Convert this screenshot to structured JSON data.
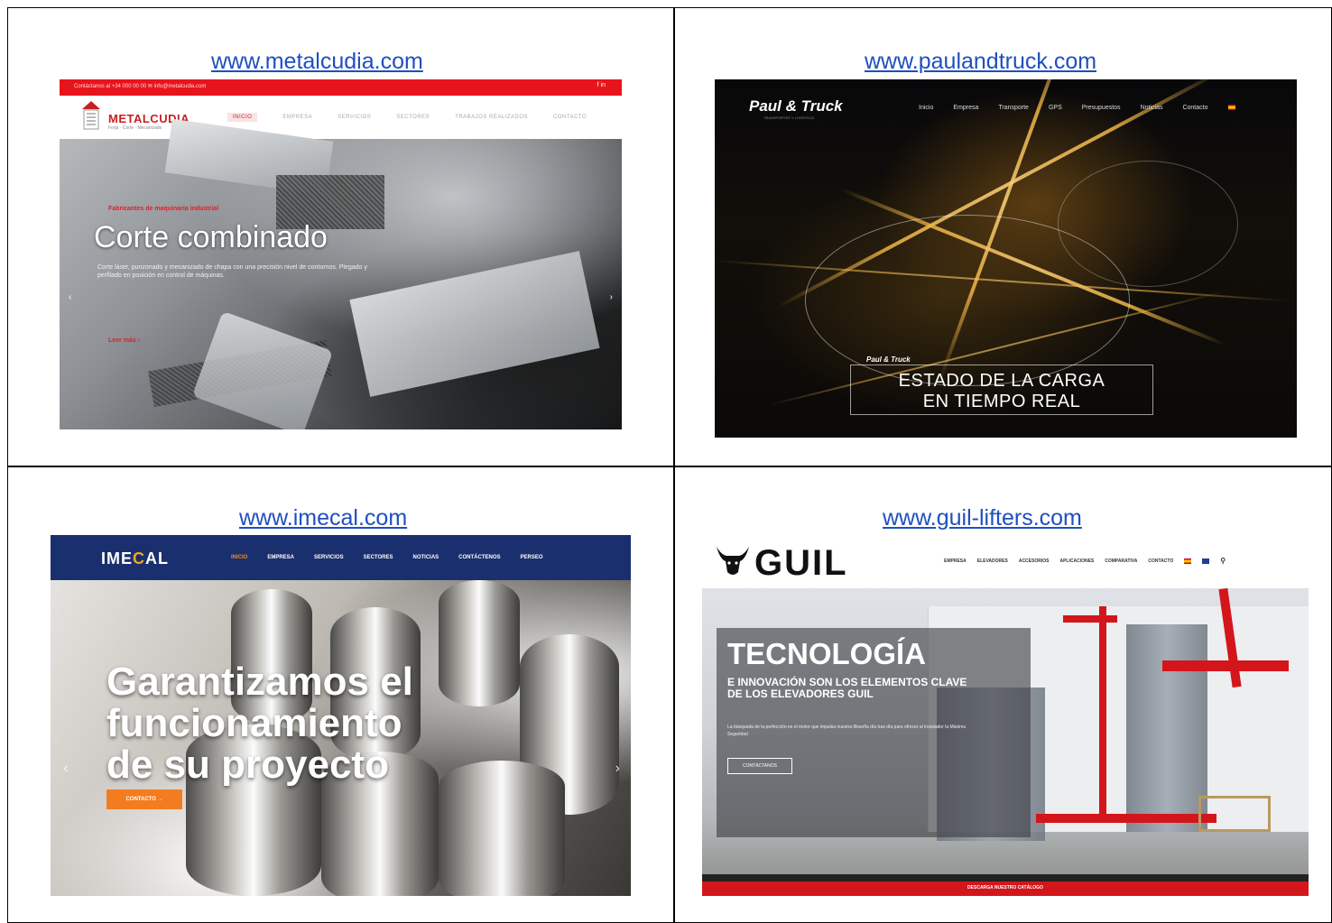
{
  "cells": [
    {
      "url": "www.metalcudia.com",
      "site": {
        "topbar_contact": "Contáctanos al  +34 000 00 00   ✉ info@metalcudia.com",
        "social": "f  in",
        "logo": "METALCUDIA",
        "logo_sub": "Forja · Corte · Mecanizado",
        "menu": [
          "INICIO",
          "EMPRESA",
          "SERVICIOS",
          "SECTORES",
          "TRABAJOS REALIZADOS",
          "CONTACTO"
        ],
        "kicker": "Fabricantes de maquinaria industrial",
        "headline": "Corte combinado",
        "description": "Corte láser, punzonado y mecanizado de chapa con una precisión nivel de contornos. Plegado y perfilado en posición en control de máquinas.",
        "more": "Leer más  ›"
      }
    },
    {
      "url": "www.paulandtruck.com",
      "site": {
        "logo": "Paul & Truck",
        "logo_sub": "TRANSPORTES Y LOGÍSTICA",
        "menu": [
          "Inicio",
          "Empresa",
          "Transporte",
          "GPS",
          "Presupuestos",
          "Noticias",
          "Contacto"
        ],
        "badge": "Paul & Truck",
        "cargo_line1": "ESTADO DE LA CARGA",
        "cargo_line2": "EN TIEMPO REAL"
      }
    },
    {
      "url": "www.imecal.com",
      "site": {
        "logo_a": "IME",
        "logo_b": "C",
        "logo_c": "AL",
        "menu": [
          "INICIO",
          "EMPRESA",
          "SERVICIOS",
          "SECTORES",
          "NOTICIAS",
          "CONTÁCTENOS",
          "PERSEO"
        ],
        "headline_1": "Garantizamos el",
        "headline_2": "funcionamiento",
        "headline_3": "de su proyecto",
        "cta": "CONTACTO  →"
      }
    },
    {
      "url": "www.guil-lifters.com",
      "site": {
        "logo": "GUIL",
        "menu": [
          "EMPRESA",
          "ELEVADORES",
          "ACCESORIOS",
          "APLICACIONES",
          "COMPARATIVA",
          "CONTACTO"
        ],
        "title": "TECNOLOGÍA",
        "subtitle_1": "E INNOVACIÓN SON LOS ELEMENTOS CLAVE",
        "subtitle_2": "DE LOS ELEVADORES GUIL",
        "body": "La búsqueda de la perfección es el motor que impulsa nuestra filosofía día tras día para ofrecer al instalador la Máxima Seguridad",
        "button": "CONTÁCTANOS",
        "footer": "DESCARGA NUESTRO CATÁLOGO"
      }
    }
  ]
}
